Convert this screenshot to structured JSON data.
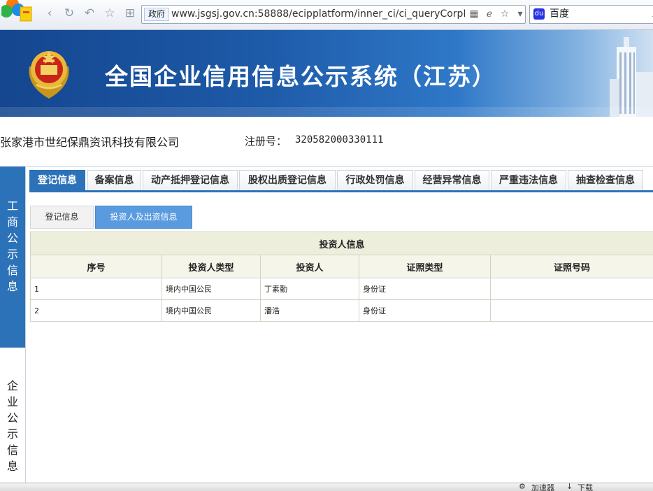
{
  "browser": {
    "address_badge": "政府",
    "url": "www.jsgsj.gov.cn:58888/ecipplatform/inner_ci/ci_queryCorpInf",
    "search_engine": "百度",
    "icons": [
      "back-icon",
      "refresh-icon",
      "undo-icon",
      "star-icon",
      "grid-icon",
      "qr-icon",
      "ie-icon",
      "favorite-icon",
      "dropdown-icon",
      "search-icon"
    ]
  },
  "banner": {
    "title": "全国企业信用信息公示系统（江苏）"
  },
  "company": {
    "name": "张家港市世纪保鼎资讯科技有限公司",
    "regno_label": "注册号：",
    "regno_value": "320582000330111"
  },
  "side": {
    "gongshang": "工\n商\n公\n示\n信\n息",
    "qiye": "企\n业\n公\n示\n信\n息"
  },
  "tabs": [
    {
      "label": "登记信息",
      "active": true
    },
    {
      "label": "备案信息"
    },
    {
      "label": "动产抵押登记信息"
    },
    {
      "label": "股权出质登记信息"
    },
    {
      "label": "行政处罚信息"
    },
    {
      "label": "经营异常信息"
    },
    {
      "label": "严重违法信息"
    },
    {
      "label": "抽查检查信息"
    }
  ],
  "subtabs": [
    {
      "label": "登记信息"
    },
    {
      "label": "投资人及出资信息",
      "active": true
    }
  ],
  "table": {
    "caption": "投资人信息",
    "columns": [
      "序号",
      "投资人类型",
      "投资人",
      "证照类型",
      "证照号码"
    ],
    "rows": [
      [
        "1",
        "境内中国公民",
        "丁素勤",
        "身份证",
        ""
      ],
      [
        "2",
        "境内中国公民",
        "潘浩",
        "身份证",
        ""
      ]
    ]
  },
  "statusbar": {
    "accelerator": "加速器",
    "download": "下载"
  },
  "colors": {
    "accent": "#2c72b8",
    "subtab_active": "#5a9be0",
    "table_header": "#eeeedd"
  }
}
